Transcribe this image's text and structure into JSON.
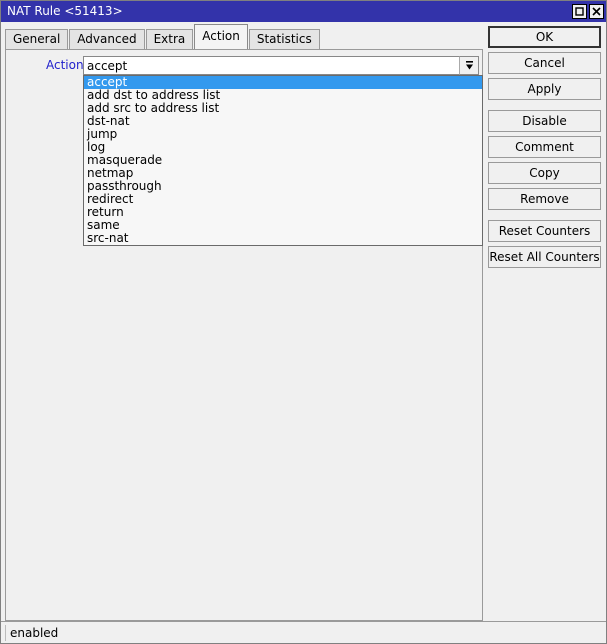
{
  "window": {
    "title": "NAT Rule <51413>",
    "controls": [
      {
        "name": "maximize-button",
        "glyph": "maximize"
      },
      {
        "name": "close-button",
        "glyph": "close"
      }
    ]
  },
  "tabs": [
    {
      "label": "General",
      "active": false
    },
    {
      "label": "Advanced",
      "active": false
    },
    {
      "label": "Extra",
      "active": false
    },
    {
      "label": "Action",
      "active": true
    },
    {
      "label": "Statistics",
      "active": false
    }
  ],
  "form": {
    "action_label": "Action:",
    "action_value": "accept",
    "action_placeholder": "",
    "dropdown_icon": "dropdown-arrow-icon"
  },
  "dropdown": {
    "open": true,
    "selected": "accept",
    "options": [
      "accept",
      "add dst to address list",
      "add src to address list",
      "dst-nat",
      "jump",
      "log",
      "masquerade",
      "netmap",
      "passthrough",
      "redirect",
      "return",
      "same",
      "src-nat"
    ]
  },
  "buttons": [
    {
      "label": "OK",
      "name": "ok-button",
      "default": true,
      "gap": false
    },
    {
      "label": "Cancel",
      "name": "cancel-button",
      "default": false,
      "gap": false
    },
    {
      "label": "Apply",
      "name": "apply-button",
      "default": false,
      "gap": true
    },
    {
      "label": "Disable",
      "name": "disable-button",
      "default": false,
      "gap": false
    },
    {
      "label": "Comment",
      "name": "comment-button",
      "default": false,
      "gap": false
    },
    {
      "label": "Copy",
      "name": "copy-button",
      "default": false,
      "gap": false
    },
    {
      "label": "Remove",
      "name": "remove-button",
      "default": false,
      "gap": true
    },
    {
      "label": "Reset Counters",
      "name": "reset-counters-button",
      "default": false,
      "gap": false
    },
    {
      "label": "Reset All Counters",
      "name": "reset-all-counters-button",
      "default": false,
      "gap": false
    }
  ],
  "statusbar": {
    "text": "enabled"
  },
  "colors": {
    "titlebar": "#3333aa",
    "highlight": "#3399ee",
    "label_text": "#2222cc",
    "window_bg": "#f0f0f0"
  }
}
